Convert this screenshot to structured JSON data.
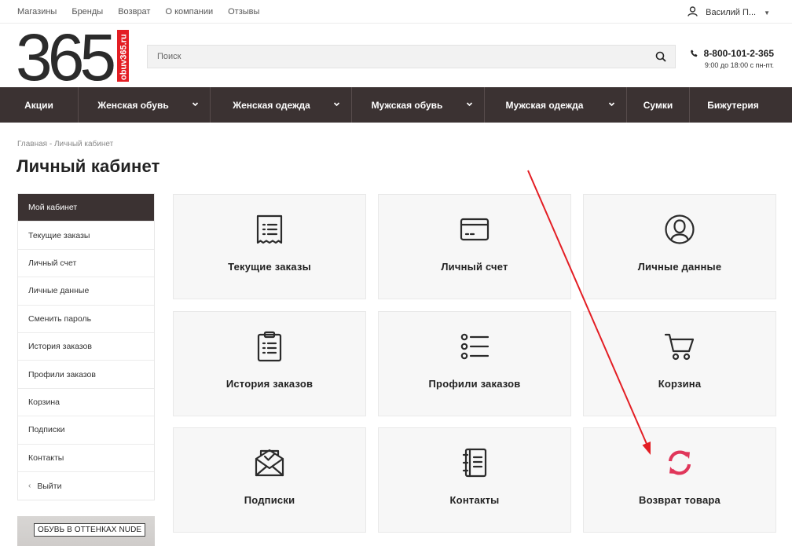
{
  "topbar": {
    "links": [
      "Магазины",
      "Бренды",
      "Возврат",
      "О компании",
      "Отзывы"
    ],
    "user_name": "Василий П..."
  },
  "logo": {
    "digits": "365",
    "site": "obuv365.ru"
  },
  "search": {
    "placeholder": "Поиск",
    "value": ""
  },
  "contact": {
    "phone": "8-800-101-2-365",
    "hours": "9:00 до 18:00 с пн-пт."
  },
  "nav": [
    "Акции",
    "Женская обувь",
    "Женская одежда",
    "Мужская обувь",
    "Мужская одежда",
    "Сумки",
    "Бижутерия"
  ],
  "breadcrumb": {
    "home": "Главная",
    "separator": "-",
    "current": "Личный кабинет"
  },
  "page_title": "Личный кабинет",
  "sidebar": {
    "items": [
      "Мой кабинет",
      "Текущие заказы",
      "Личный счет",
      "Личные данные",
      "Сменить пароль",
      "История заказов",
      "Профили заказов",
      "Корзина",
      "Подписки",
      "Контакты",
      "Выйти"
    ],
    "active_index": 0
  },
  "banner": {
    "text": "ОБУВЬ В ОТТЕНКАХ NUDE"
  },
  "tiles": [
    {
      "label": "Текущие заказы",
      "icon": "receipt-icon"
    },
    {
      "label": "Личный счет",
      "icon": "credit-card-icon"
    },
    {
      "label": "Личные данные",
      "icon": "user-circle-icon"
    },
    {
      "label": "История заказов",
      "icon": "clipboard-icon"
    },
    {
      "label": "Профили заказов",
      "icon": "list-icon"
    },
    {
      "label": "Корзина",
      "icon": "cart-icon"
    },
    {
      "label": "Подписки",
      "icon": "envelope-check-icon"
    },
    {
      "label": "Контакты",
      "icon": "notebook-icon"
    },
    {
      "label": "Возврат товара",
      "icon": "refresh-icon"
    }
  ],
  "colors": {
    "nav_bg": "#3b3232",
    "logo_red": "#e31e24",
    "return_icon": "#e0365a",
    "annotation_arrow": "#e31e24"
  }
}
